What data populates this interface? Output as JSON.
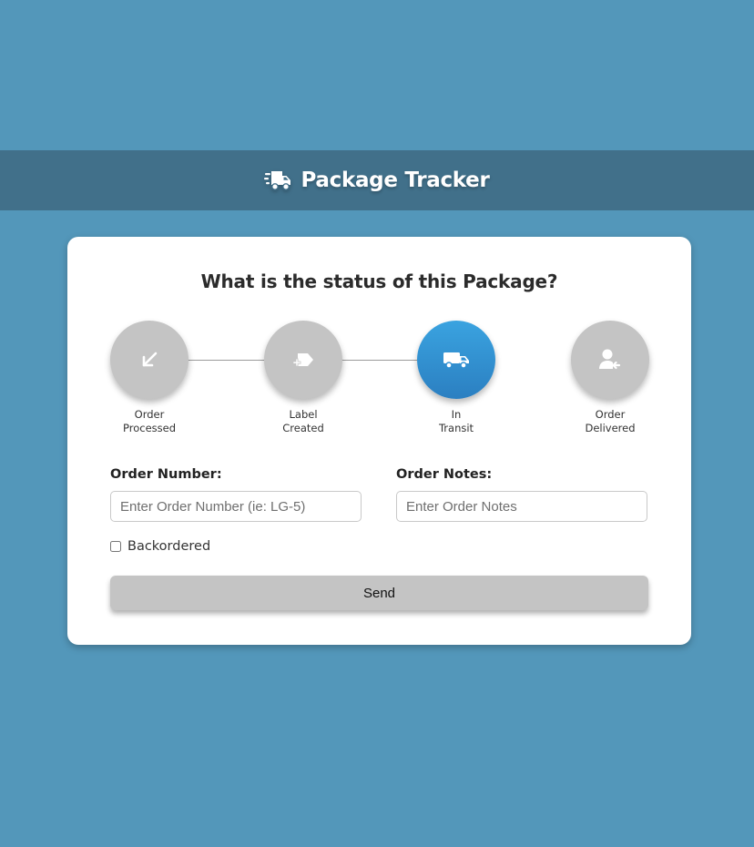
{
  "colors": {
    "background": "#5397ba",
    "header_bar": "#41708a",
    "card": "#ffffff",
    "step_inactive": "#c4c4c4",
    "step_active": "#2f8fd3",
    "button": "#c4c4c4"
  },
  "header": {
    "icon": "shipping-fast-icon",
    "title": "Package Tracker"
  },
  "card": {
    "title": "What is the status of this Package?"
  },
  "steps": [
    {
      "icon": "arrow-down-left-icon",
      "line1": "Order",
      "line2": "Processed",
      "active": false
    },
    {
      "icon": "tag-plus-icon",
      "line1": "Label",
      "line2": "Created",
      "active": false
    },
    {
      "icon": "truck-icon",
      "line1": "In",
      "line2": "Transit",
      "active": true
    },
    {
      "icon": "user-arrow-icon",
      "line1": "Order",
      "line2": "Delivered",
      "active": false
    }
  ],
  "form": {
    "order_number": {
      "label": "Order Number:",
      "placeholder": "Enter Order Number (ie: LG-5)",
      "value": ""
    },
    "order_notes": {
      "label": "Order Notes:",
      "placeholder": "Enter Order Notes",
      "value": ""
    },
    "backordered": {
      "label": "Backordered",
      "checked": false
    },
    "send_label": "Send"
  }
}
